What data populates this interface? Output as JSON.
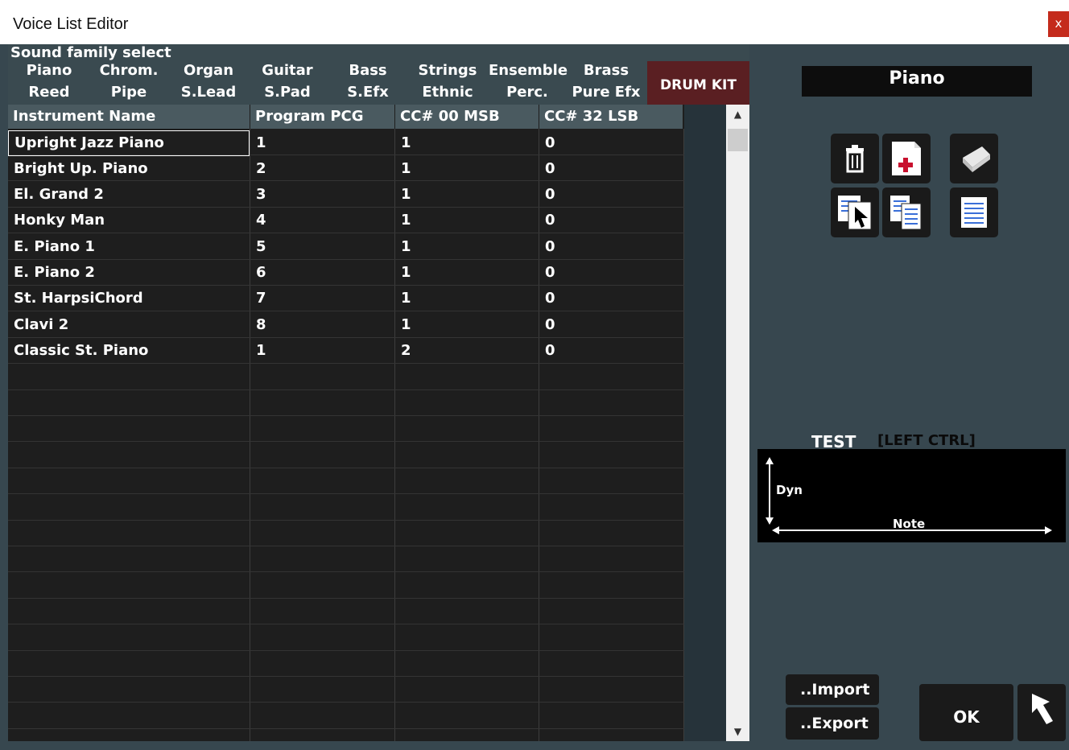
{
  "window": {
    "title": "Voice List Editor",
    "close_label": "x"
  },
  "family_panel": {
    "label": "Sound family select",
    "row1": [
      "Piano",
      "Chrom.",
      "Organ",
      "Guitar",
      "Bass",
      "Strings",
      "Ensemble",
      "Brass"
    ],
    "row2": [
      "Reed",
      "Pipe",
      "S.Lead",
      "S.Pad",
      "S.Efx",
      "Ethnic",
      "Perc.",
      "Pure Efx"
    ],
    "drum_kit": "DRUM KIT"
  },
  "grid": {
    "headers": [
      "Instrument Name",
      "Program PCG",
      "CC# 00  MSB",
      "CC# 32  LSB"
    ],
    "rows": [
      [
        "Upright Jazz Piano",
        "1",
        "1",
        "0"
      ],
      [
        "Bright Up. Piano",
        "2",
        "1",
        "0"
      ],
      [
        "El. Grand 2",
        "3",
        "1",
        "0"
      ],
      [
        "Honky Man",
        "4",
        "1",
        "0"
      ],
      [
        "E. Piano 1",
        "5",
        "1",
        "0"
      ],
      [
        "E. Piano 2",
        "6",
        "1",
        "0"
      ],
      [
        "St. HarpsiChord",
        "7",
        "1",
        "0"
      ],
      [
        "Clavi 2",
        "8",
        "1",
        "0"
      ],
      [
        "Classic St. Piano",
        "1",
        "2",
        "0"
      ]
    ]
  },
  "selected_family": "Piano",
  "tools": [
    "trash-icon",
    "add-voice-icon",
    "eraser-icon",
    "paste-icon",
    "copy-icon",
    "list-icon"
  ],
  "test": {
    "label": "TEST",
    "shortcut": "[LEFT CTRL]",
    "dyn_label": "Dyn",
    "note_label": "Note"
  },
  "buttons": {
    "import": "..Import",
    "export": "..Export",
    "ok": "OK"
  },
  "colors": {
    "background": "#37474f",
    "drum_kit": "#5a1f22",
    "close": "#c42b1c"
  }
}
